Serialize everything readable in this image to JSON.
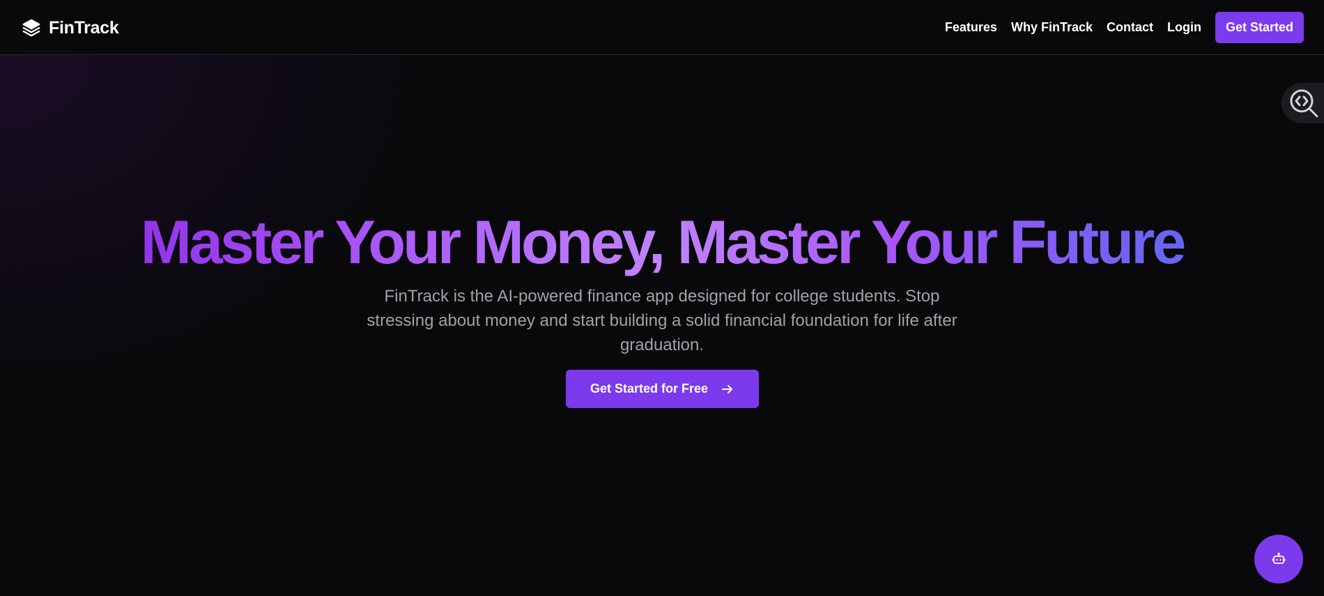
{
  "header": {
    "brand_name": "FinTrack",
    "brand_icon": "layers-icon",
    "nav": {
      "features": "Features",
      "why": "Why FinTrack",
      "contact": "Contact",
      "login": "Login",
      "cta": "Get Started"
    }
  },
  "hero": {
    "title": "Master Your Money, Master Your Future",
    "subtitle": "FinTrack is the AI-powered finance app designed for college students. Stop stressing about money and start building a solid financial foundation for life after graduation.",
    "cta_label": "Get Started for Free",
    "cta_icon": "arrow-right-icon"
  },
  "floating": {
    "inspect_icon": "code-search-icon",
    "chat_icon": "bot-icon"
  },
  "colors": {
    "background": "#09090b",
    "accent": "#7c3aed",
    "gradient_start": "#9333ea",
    "gradient_mid": "#c084fc",
    "gradient_end": "#6366f1",
    "muted_text": "#a1a1aa"
  }
}
